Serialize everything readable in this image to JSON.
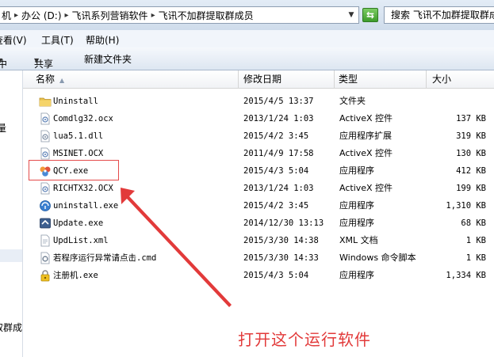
{
  "address_bar": {
    "crumbs": [
      "机",
      "办公 (D:)",
      "飞讯系列营销软件",
      "飞讯不加群提取群成员"
    ],
    "search_placeholder": "搜索 飞讯不加群提取群成员"
  },
  "menu": {
    "view": "查看(V)",
    "tools": "工具(T)",
    "help": "帮助(H)"
  },
  "toolbar": {
    "open_partial": "中",
    "share": "共享",
    "new_folder": "新建文件夹"
  },
  "nav_pane": {
    "item_partial_1": "量",
    "item_partial_2": "取群成"
  },
  "columns": {
    "name": "名称",
    "modified": "修改日期",
    "type": "类型",
    "size": "大小"
  },
  "files": [
    {
      "icon": "folder-icon",
      "name": "Uninstall",
      "modified": "2015/4/5 13:37",
      "type": "文件夹",
      "size": ""
    },
    {
      "icon": "ocx-file-icon",
      "name": "Comdlg32.ocx",
      "modified": "2013/1/24 1:03",
      "type": "ActiveX 控件",
      "size": "137 KB"
    },
    {
      "icon": "dll-file-icon",
      "name": "lua5.1.dll",
      "modified": "2015/4/2 3:45",
      "type": "应用程序扩展",
      "size": "319 KB"
    },
    {
      "icon": "ocx-file-icon",
      "name": "MSINET.OCX",
      "modified": "2011/4/9 17:58",
      "type": "ActiveX 控件",
      "size": "130 KB"
    },
    {
      "icon": "app-exe-icon",
      "name": "QCY.exe",
      "modified": "2015/4/3 5:04",
      "type": "应用程序",
      "size": "412 KB"
    },
    {
      "icon": "ocx-file-icon",
      "name": "RICHTX32.OCX",
      "modified": "2013/1/24 1:03",
      "type": "ActiveX 控件",
      "size": "199 KB"
    },
    {
      "icon": "uninstall-exe-icon",
      "name": "uninstall.exe",
      "modified": "2015/4/2 3:45",
      "type": "应用程序",
      "size": "1,310 KB"
    },
    {
      "icon": "update-exe-icon",
      "name": "Update.exe",
      "modified": "2014/12/30 13:13",
      "type": "应用程序",
      "size": "68 KB"
    },
    {
      "icon": "xml-file-icon",
      "name": "UpdList.xml",
      "modified": "2015/3/30 14:38",
      "type": "XML 文档",
      "size": "1 KB"
    },
    {
      "icon": "cmd-file-icon",
      "name": "若程序运行异常请点击.cmd",
      "modified": "2015/3/30 14:33",
      "type": "Windows 命令脚本",
      "size": "1 KB"
    },
    {
      "icon": "lock-exe-icon",
      "name": "注册机.exe",
      "modified": "2015/4/3 5:04",
      "type": "应用程序",
      "size": "1,334 KB"
    }
  ],
  "annotation": {
    "text": "打开这个运行软件",
    "color": "#e23a3a"
  }
}
